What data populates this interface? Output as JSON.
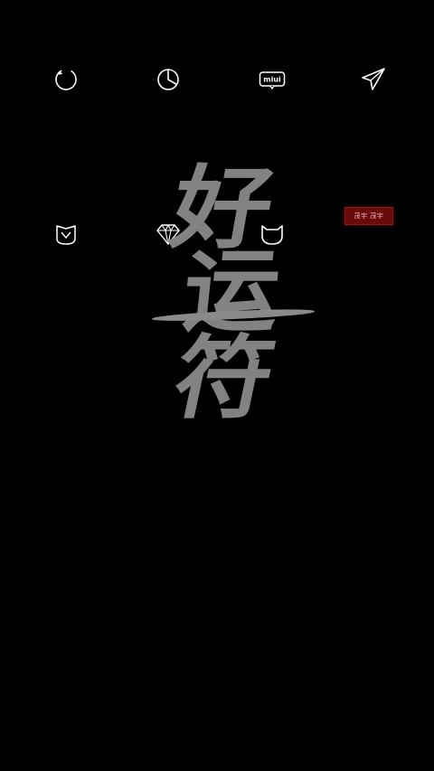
{
  "theme": {
    "background": "#000000",
    "icon_color": "#ffffff",
    "calligraphy_color": "#8a8a8a",
    "seal_color": "#6b0a0a"
  },
  "icons_row1": [
    {
      "name": "refresh-icon"
    },
    {
      "name": "pie-chart-icon"
    },
    {
      "name": "miui-icon",
      "label": "miui"
    },
    {
      "name": "send-icon"
    }
  ],
  "icons_row2": [
    {
      "name": "mi-home-icon"
    },
    {
      "name": "diamond-icon"
    },
    {
      "name": "mi-bunny-icon"
    }
  ],
  "seal": {
    "text": "茂宇 茂宇"
  },
  "calligraphy": {
    "char1": "好",
    "char2": "运",
    "char3": "符"
  }
}
